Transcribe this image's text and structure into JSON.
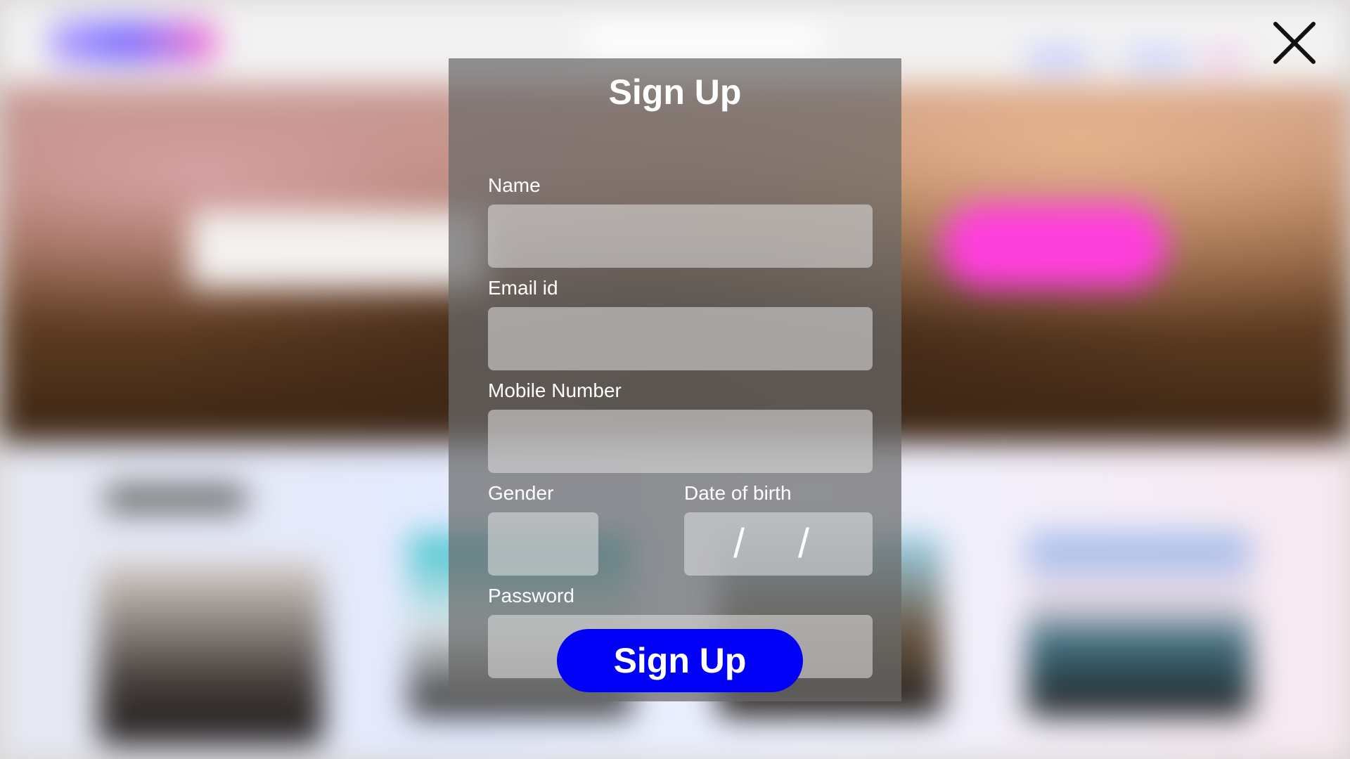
{
  "modal": {
    "title": "Sign Up",
    "fields": {
      "name": {
        "label": "Name",
        "value": "",
        "placeholder": ""
      },
      "email": {
        "label": "Email id",
        "value": "",
        "placeholder": ""
      },
      "mobile": {
        "label": "Mobile Number",
        "value": "",
        "placeholder": ""
      },
      "gender": {
        "label": "Gender",
        "value": ""
      },
      "dob": {
        "label": "Date of birth",
        "separator": "/"
      },
      "password": {
        "label": "Password",
        "value": "",
        "placeholder": ""
      }
    },
    "submit_label": "Sign Up"
  },
  "close": {
    "icon": "close-icon"
  },
  "colors": {
    "overlay": "#696969",
    "submit_button": "#0000f7",
    "text": "#ffffff",
    "hero_pill": "#ff3fdc"
  }
}
